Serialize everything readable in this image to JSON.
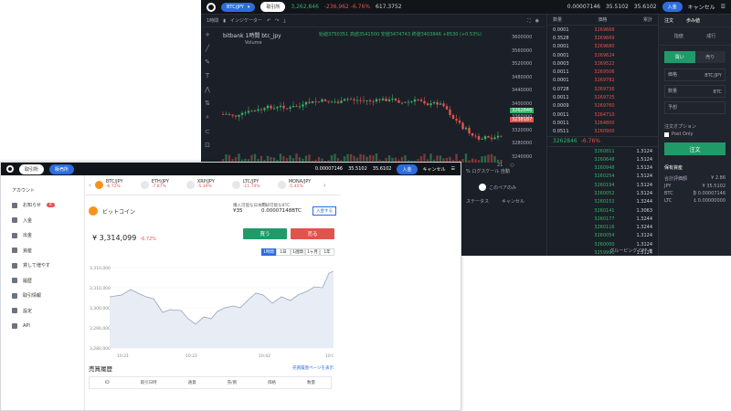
{
  "back": {
    "pair_pill": "BTC/JPY",
    "view_pill": "取引所",
    "price": "3,262,846",
    "change": "-236,962 -6.76%",
    "ticker2": "617.3752",
    "top_right": {
      "val1": "0.00007146",
      "val2": "35.5102",
      "val3": "35.6102",
      "login": "入金",
      "cancel": "キャンセル"
    },
    "indicator_label": "インジケーター",
    "chart_title": "bitbank 1時間 btc_jpy",
    "ohlc": {
      "open": "始値3750351",
      "high": "高値3541500",
      "low": "安値3474743",
      "close": "終値3403846 +8530 (+0.53%)"
    },
    "volume_label": "Volume",
    "yaxis": [
      "3600000",
      "3560000",
      "3520000",
      "3480000",
      "3440000",
      "3400000",
      "3360000",
      "3320000",
      "3280000",
      "3240000"
    ],
    "price_tag_green": "3262846",
    "price_tag_red": "3238187",
    "bottom_items": [
      "21",
      "○"
    ],
    "mid2": {
      "log": "% ログスケール 自動",
      "only_pair": "このペアのみ",
      "status": "ステータス",
      "cancel": "キャンセル"
    },
    "orderbook": {
      "headers": [
        "数量",
        "価格",
        "累計"
      ],
      "asks": [
        [
          "0.0001",
          "3269666",
          ""
        ],
        [
          "0.3528",
          "3269669",
          ""
        ],
        [
          "0.0001",
          "3269680",
          ""
        ],
        [
          "0.0001",
          "3269624",
          ""
        ],
        [
          "0.0003",
          "3269522",
          ""
        ],
        [
          "0.0011",
          "3269506",
          ""
        ],
        [
          "0.0001",
          "3269782",
          ""
        ],
        [
          "0.0728",
          "3269736",
          ""
        ],
        [
          "0.0011",
          "3269725",
          ""
        ],
        [
          "0.0009",
          "3269760",
          ""
        ],
        [
          "0.0011",
          "3264710",
          ""
        ],
        [
          "0.0011",
          "3264800",
          ""
        ],
        [
          "0.0511",
          "3260900",
          ""
        ]
      ],
      "mid_price": "3262846",
      "mid_change": "-6.76%",
      "bids": [
        [
          "",
          "3260811",
          "1.3124"
        ],
        [
          "",
          "3260648",
          "1.5124"
        ],
        [
          "",
          "3260948",
          "1.5124"
        ],
        [
          "",
          "3260254",
          "1.5124"
        ],
        [
          "",
          "3260194",
          "1.5124"
        ],
        [
          "",
          "3260052",
          "1.5124"
        ],
        [
          "",
          "3260153",
          "1.3244"
        ],
        [
          "",
          "3260141",
          "1.3063"
        ],
        [
          "",
          "3260177",
          "1.3244"
        ],
        [
          "",
          "3260116",
          "1.3244"
        ],
        [
          "",
          "3260054",
          "1.3124"
        ],
        [
          "",
          "3260000",
          "1.3124"
        ],
        [
          "",
          "3259990",
          "1.3124"
        ],
        [
          "",
          "3259900",
          "1.3124"
        ]
      ],
      "grouping": "グルーピング OFF ▼"
    },
    "order_panel": {
      "tabs": [
        "注文",
        "歩み値"
      ],
      "sub": [
        "指値",
        "成行"
      ],
      "buy": "買い",
      "sell": "売り",
      "price_label": "価格",
      "price_unit": "BTC/JPY",
      "qty_label": "数量",
      "qty_unit": "BTC",
      "limit_label": "予想",
      "options": "注文オプション",
      "post_only": "Post Only",
      "order_btn": "注文",
      "holdings": "保有資産",
      "total_label": "合計評価額",
      "total": "¥ 2.86",
      "rows": [
        [
          "JPY",
          "¥ 35.5102"
        ],
        [
          "BTC",
          "₿ 0.00007146"
        ],
        [
          "LTC",
          "Ł 0.00000000"
        ]
      ]
    }
  },
  "front": {
    "top": {
      "pill1": "取引所",
      "pill2": "販売所",
      "login": "入金",
      "cancel": "キャンセル",
      "v1": "0.00007146",
      "v2": "35.5102",
      "v3": "35.6102"
    },
    "sidebar": [
      {
        "label": "アカウント",
        "icon": "account-icon"
      },
      {
        "label": "お知らせ",
        "icon": "bell-icon",
        "badge": "8"
      },
      {
        "label": "入金",
        "icon": "deposit-icon"
      },
      {
        "label": "出金",
        "icon": "withdraw-icon"
      },
      {
        "label": "資産",
        "icon": "asset-icon"
      },
      {
        "label": "貸して増やす",
        "icon": "lend-icon"
      },
      {
        "label": "履歴",
        "icon": "history-icon"
      },
      {
        "label": "取引情報",
        "icon": "info-icon"
      },
      {
        "label": "設定",
        "icon": "gear-icon"
      },
      {
        "label": "API",
        "icon": "api-icon"
      }
    ],
    "pairs": [
      {
        "name": "BTC/JPY",
        "change": "-6.72%",
        "color": "#e0544c",
        "on": true
      },
      {
        "name": "ETH/JPY",
        "change": "-7.87%",
        "color": "#e0544c"
      },
      {
        "name": "XRP/JPY",
        "change": "-5.39%",
        "color": "#e0544c"
      },
      {
        "name": "LTC/JPY",
        "change": "-11.74%",
        "color": "#e0544c"
      },
      {
        "name": "MONA/JPY",
        "change": "-5.45%",
        "color": "#e0544c"
      }
    ],
    "coin_name": "ビットコイン",
    "bal1": {
      "label": "購入可能な日本円",
      "value": "¥35"
    },
    "bal2": {
      "label": "売却可能なBTC",
      "value": "0.00007148BTC"
    },
    "deposit_btn": "入金する",
    "price": "¥ 3,314,099",
    "price_change": "-6.72%",
    "buy_btn": "買う",
    "sell_btn": "売る",
    "ranges": [
      "1時間",
      "1日",
      "1週間",
      "1ヶ月",
      "1年"
    ],
    "chart_yticks": [
      "3,310,000",
      "3,310,000",
      "3,300,000",
      "3,290,000",
      "3,280,000"
    ],
    "chart_xticks": [
      "10:21",
      "10:22",
      "10:42",
      "10:03"
    ],
    "history_title": "売買履歴",
    "history_link": "売買履歴ページを表示",
    "history_cols": [
      "ID",
      "取引日時",
      "通貨",
      "売/買",
      "価格",
      "数量"
    ]
  }
}
